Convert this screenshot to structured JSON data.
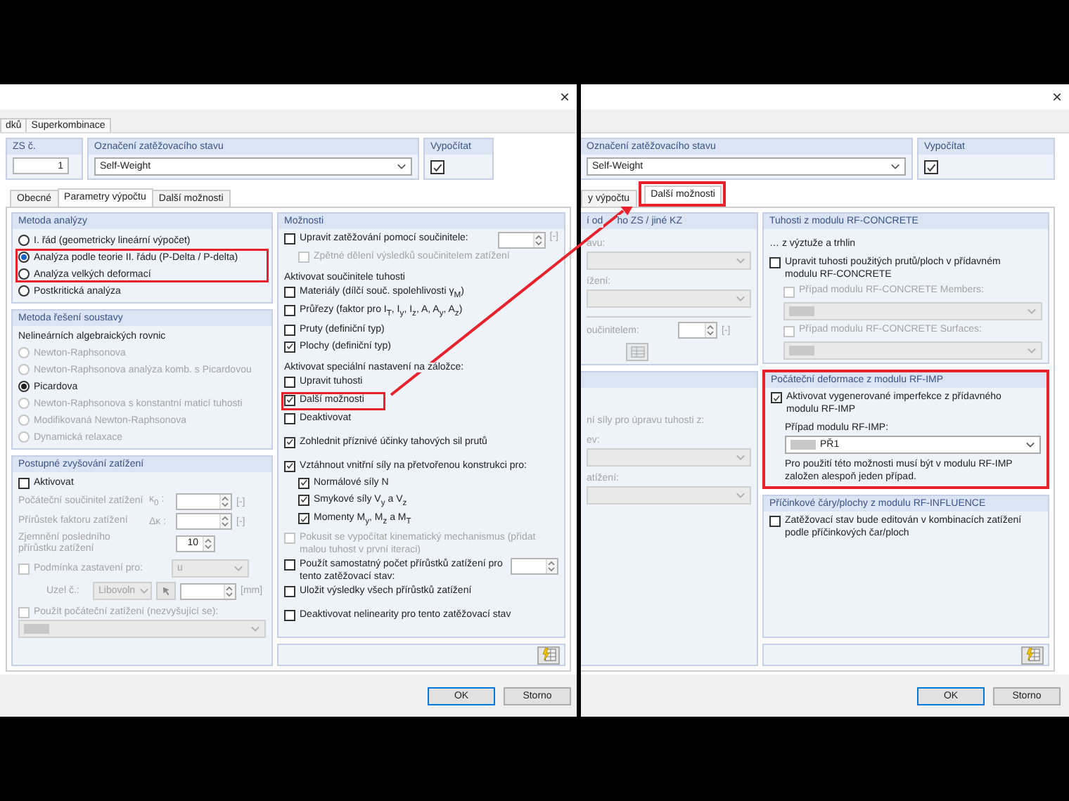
{
  "left_dialog": {
    "close": "×",
    "outer_tabs": [
      {
        "label": "dků",
        "selected": false
      },
      {
        "label": "Superkombinace",
        "selected": false
      }
    ],
    "case_number": {
      "label": "ZS č.",
      "value": "1"
    },
    "case_name": {
      "label": "Označení zatěžovacího stavu",
      "value": "Self-Weight"
    },
    "calculate": {
      "label": "Vypočítat",
      "checked": true
    },
    "tabs": [
      {
        "label": "Obecné",
        "selected": false
      },
      {
        "label": "Parametry výpočtu",
        "selected": true
      },
      {
        "label": "Další možnosti",
        "selected": false
      }
    ],
    "analysis_method": {
      "title": "Metoda analýzy",
      "options": [
        {
          "label": "I. řád (geometricky lineární výpočet)",
          "selected": false,
          "disabled": false,
          "highlighted": false
        },
        {
          "label": "Analýza podle teorie II. řádu (P-Delta / P-delta)",
          "selected": true,
          "disabled": false,
          "highlighted": true
        },
        {
          "label": "Analýza velkých deformací",
          "selected": false,
          "disabled": false,
          "highlighted": true
        },
        {
          "label": "Postkritická analýza",
          "selected": false,
          "disabled": false,
          "highlighted": false
        }
      ]
    },
    "solver_method": {
      "title": "Metoda řešení soustavy",
      "subtitle": "Nelineárních algebraických rovnic",
      "options": [
        {
          "label": "Newton-Raphsonova",
          "selected": false,
          "disabled": true,
          "highlighted": false
        },
        {
          "label": "Newton-Raphsonova analýza komb. s Picardovou",
          "selected": false,
          "disabled": true,
          "highlighted": false
        },
        {
          "label": "Picardova",
          "selected": true,
          "disabled": false,
          "highlighted": false
        },
        {
          "label": "Newton-Raphsonova s konstantní maticí tuhosti",
          "selected": false,
          "disabled": true,
          "highlighted": false
        },
        {
          "label": "Modifikovaná Newton-Raphsonova",
          "selected": false,
          "disabled": true,
          "highlighted": false
        },
        {
          "label": "Dynamická relaxace",
          "selected": false,
          "disabled": true,
          "highlighted": false
        }
      ]
    },
    "load_increment": {
      "title": "Postupné zvyšování zatížení",
      "activate": {
        "label": "Aktivovat",
        "checked": false
      },
      "rows": [
        {
          "label": "Počáteční součinitel zatížení",
          "symbol": "κ$_{0}$ :",
          "unit": "[-]"
        },
        {
          "label": "Přírůstek faktoru zatížení",
          "symbol": "Δκ :",
          "unit": "[-]"
        },
        {
          "label": "Zjemnění posledního přírůstku zatížení",
          "value": "10"
        }
      ],
      "stop": {
        "label": "Podmínka zastavení pro:",
        "checked": false,
        "value": "u"
      },
      "node": {
        "label": "Uzel č.:",
        "value": "Libovoln",
        "unit": "[mm]"
      },
      "initial": {
        "label": "Použít počáteční zatížení (nezvyšující se):",
        "checked": false
      }
    },
    "options": {
      "title": "Možnosti",
      "sections": [
        [
          {
            "kind": "check_spin",
            "label": "Upravit zatěžování pomocí součinitele:",
            "checked": false,
            "disabled": false,
            "highlighted": false,
            "unit": "[-]",
            "children": [
              {
                "label": "Zpětné dělení výsledků součinitelem zatížení",
                "checked": false,
                "disabled": true
              }
            ]
          },
          {
            "kind": "heading",
            "label": "Aktivovat součinitele tuhosti"
          },
          {
            "kind": "check",
            "label": "Materiály (dílčí souč. spolehlivosti γ$_{M}$)",
            "checked": false,
            "disabled": false,
            "highlighted": false
          },
          {
            "kind": "check",
            "label": "Průřezy (faktor pro I$_{T}$, I$_{y}$, I$_{z}$, A, A$_{y}$, A$_{z}$)",
            "checked": false,
            "disabled": false,
            "highlighted": false
          },
          {
            "kind": "check",
            "label": "Pruty (definiční typ)",
            "checked": false,
            "disabled": false,
            "highlighted": false
          },
          {
            "kind": "check",
            "label": "Plochy (definiční typ)",
            "checked": true,
            "disabled": false,
            "highlighted": false
          },
          {
            "kind": "heading",
            "label": "Aktivovat speciální nastavení na záložce:"
          },
          {
            "kind": "check",
            "label": "Upravit tuhosti",
            "checked": false,
            "disabled": false,
            "highlighted": false
          },
          {
            "kind": "check",
            "label": "Další možnosti",
            "checked": true,
            "disabled": false,
            "highlighted": true
          },
          {
            "kind": "check",
            "label": "Deaktivovat",
            "checked": false,
            "disabled": false,
            "highlighted": false
          }
        ],
        [
          {
            "kind": "check",
            "label": "Zohlednit příznivé účinky tahových sil prutů",
            "checked": true,
            "disabled": false,
            "highlighted": false
          }
        ],
        [
          {
            "kind": "check",
            "label": "Vztáhnout vnitřní síly na přetvořenou konstrukci pro:",
            "checked": true,
            "disabled": false,
            "highlighted": false,
            "children": [
              {
                "label": "Normálové síly N",
                "checked": true,
                "disabled": false
              },
              {
                "label": "Smykové síly V$_{y}$ a V$_{z}$",
                "checked": true,
                "disabled": false
              },
              {
                "label": "Momenty M$_{y}$, M$_{z}$ a M$_{T}$",
                "checked": true,
                "disabled": false
              }
            ]
          },
          {
            "kind": "check",
            "label": "Pokusit se vypočítat kinematický mechanismus (přidat malou tuhost v první iteraci)",
            "checked": false,
            "disabled": true,
            "highlighted": false
          },
          {
            "kind": "check_spin",
            "label": "Použít samostatný počet přírůstků zatížení pro tento zatěžovací stav:",
            "checked": false,
            "disabled": false,
            "highlighted": false
          },
          {
            "kind": "check",
            "label": "Uložit výsledky všech přírůstků zatížení",
            "checked": false,
            "disabled": false,
            "highlighted": false
          }
        ],
        [
          {
            "kind": "check",
            "label": "Deaktivovat nelinearity pro tento zatěžovací stav",
            "checked": false,
            "disabled": false,
            "highlighted": false
          }
        ]
      ]
    },
    "buttons": [
      "OK",
      "Storno"
    ]
  },
  "right_dialog": {
    "close": "×",
    "case_name": {
      "label": "Označení zatěžovacího stavu",
      "value": "Self-Weight"
    },
    "calculate": {
      "label": "Vypočítat",
      "checked": true
    },
    "tabs": [
      {
        "label": "y výpočtu",
        "selected": false,
        "highlighted": false
      },
      {
        "label": "Další možnosti",
        "selected": true,
        "highlighted": true
      }
    ],
    "stiffness_group": {
      "title": [
        "í od",
        "ho ZS / jiné KZ"
      ],
      "field_1": "avu:",
      "field_2": "ížení:",
      "factor": {
        "label": "oučinitelem:",
        "unit": "[-]"
      }
    },
    "forces_group": {
      "label": "ní síly pro úpravu tuhosti z:",
      "field_1": "ev:",
      "field_2": "atížení:"
    },
    "concrete": {
      "title": "Tuhosti z modulu RF-CONCRETE",
      "note": "… z výztuže a trhlin",
      "adjust": {
        "label": "Upravit tuhosti použitých prutů/ploch v přídavném modulu RF-CONCRETE",
        "checked": false
      },
      "cases": [
        {
          "label": "Případ modulu RF-CONCRETE Members:",
          "checked": false,
          "disabled": true
        },
        {
          "label": "Případ modulu RF-CONCRETE Surfaces:",
          "checked": false,
          "disabled": true
        }
      ]
    },
    "imperfection": {
      "title": "Počáteční deformace z modulu RF-IMP",
      "highlighted": true,
      "activate": {
        "label": "Aktivovat vygenerované imperfekce z přídavného modulu RF-IMP",
        "checked": true
      },
      "case_label": "Případ modulu RF-IMP:",
      "case_value": "PŘ1",
      "note": "Pro použití této možnosti musí být v modulu RF-IMP založen alespoň jeden případ."
    },
    "influence": {
      "title": "Příčinkové čáry/plochy z modulu RF-INFLUENCE",
      "edit": {
        "label": "Zatěžovací stav bude editován v kombinacích zatížení podle příčinkových čar/ploch",
        "checked": false
      }
    },
    "buttons": [
      "OK",
      "Storno"
    ]
  }
}
